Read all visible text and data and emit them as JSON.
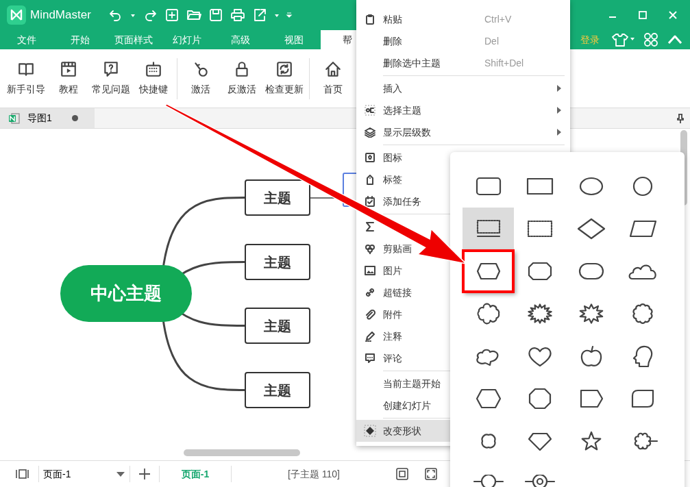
{
  "app": {
    "name": "MindMaster"
  },
  "ribbon_tabs": [
    {
      "label": "文件",
      "selected": false
    },
    {
      "label": "开始",
      "selected": false
    },
    {
      "label": "页面样式",
      "selected": false
    },
    {
      "label": "幻灯片",
      "selected": false
    },
    {
      "label": "高级",
      "selected": false
    },
    {
      "label": "视图",
      "selected": false
    },
    {
      "label": "帮",
      "selected": true
    }
  ],
  "login": "登录",
  "toolbar_groups": [
    [
      {
        "label": "新手引导"
      },
      {
        "label": "教程"
      },
      {
        "label": "常见问题"
      },
      {
        "label": "快捷键"
      }
    ],
    [
      {
        "label": "激活"
      },
      {
        "label": "反激活"
      },
      {
        "label": "检查更新"
      }
    ],
    [
      {
        "label": "首页"
      }
    ]
  ],
  "doc_tabs": [
    {
      "title": "导图1",
      "modified": true
    }
  ],
  "mind_map": {
    "central": "中心主题",
    "topics": [
      "主题",
      "主题",
      "主题",
      "主题"
    ]
  },
  "context_menu": {
    "items": [
      {
        "kind": "item",
        "label": "粘贴",
        "shortcut": "Ctrl+V",
        "submenu": false,
        "selected": false
      },
      {
        "kind": "item",
        "label": "删除",
        "shortcut": "Del",
        "submenu": false,
        "selected": false
      },
      {
        "kind": "item",
        "label": "删除选中主题",
        "shortcut": "Shift+Del",
        "submenu": false,
        "selected": false
      },
      {
        "kind": "separator"
      },
      {
        "kind": "item",
        "label": "插入",
        "submenu": true,
        "selected": false
      },
      {
        "kind": "item",
        "label": "选择主题",
        "submenu": true,
        "selected": false
      },
      {
        "kind": "item",
        "label": "显示层级数",
        "submenu": true,
        "selected": false
      },
      {
        "kind": "separator"
      },
      {
        "kind": "item",
        "label": "图标",
        "submenu": false,
        "selected": false
      },
      {
        "kind": "item",
        "label": "标签",
        "submenu": false,
        "selected": false
      },
      {
        "kind": "item",
        "label": "添加任务",
        "submenu": false,
        "selected": false
      },
      {
        "kind": "separator"
      },
      {
        "kind": "item",
        "submenu": false,
        "selected": false
      },
      {
        "kind": "item",
        "label": "剪贴画",
        "submenu": false,
        "selected": false
      },
      {
        "kind": "item",
        "label": "图片",
        "submenu": false,
        "selected": false
      },
      {
        "kind": "item",
        "label": "超链接",
        "submenu": false,
        "selected": false
      },
      {
        "kind": "item",
        "label": "附件",
        "submenu": false,
        "selected": false
      },
      {
        "kind": "item",
        "label": "注释",
        "submenu": false,
        "selected": false
      },
      {
        "kind": "item",
        "label": "评论",
        "submenu": false,
        "selected": false
      },
      {
        "kind": "separator"
      },
      {
        "kind": "item",
        "label": "当前主题开始",
        "submenu": false,
        "selected": false
      },
      {
        "kind": "item",
        "label": "创建幻灯片",
        "submenu": false,
        "selected": false
      },
      {
        "kind": "separator"
      },
      {
        "kind": "item",
        "label": "改变形状",
        "submenu": false,
        "selected": true
      }
    ]
  },
  "shape_panel": {
    "shapes": [
      {
        "selected": false,
        "highlighted": false
      },
      {
        "selected": false,
        "highlighted": false
      },
      {
        "selected": false,
        "highlighted": false
      },
      {
        "selected": false,
        "highlighted": false
      },
      {
        "selected": true,
        "highlighted": false
      },
      {
        "selected": false,
        "highlighted": false
      },
      {
        "selected": false,
        "highlighted": false
      },
      {
        "selected": false,
        "highlighted": false
      },
      {
        "selected": false,
        "highlighted": true
      },
      {
        "selected": false,
        "highlighted": false
      },
      {
        "selected": false,
        "highlighted": false
      },
      {
        "selected": false,
        "highlighted": false
      },
      {
        "selected": false,
        "highlighted": false
      },
      {
        "selected": false,
        "highlighted": false
      },
      {
        "selected": false,
        "highlighted": false
      },
      {
        "selected": false,
        "highlighted": false
      },
      {
        "selected": false,
        "highlighted": false
      },
      {
        "selected": false,
        "highlighted": false
      },
      {
        "selected": false,
        "highlighted": false
      },
      {
        "selected": false,
        "highlighted": false
      },
      {
        "selected": false,
        "highlighted": false
      },
      {
        "selected": false,
        "highlighted": false
      },
      {
        "selected": false,
        "highlighted": false
      },
      {
        "selected": false,
        "highlighted": false
      },
      {
        "selected": false,
        "highlighted": false
      },
      {
        "selected": false,
        "highlighted": false
      },
      {
        "selected": false,
        "highlighted": false
      },
      {
        "selected": false,
        "highlighted": false
      },
      {
        "selected": false,
        "highlighted": false
      },
      {
        "selected": false,
        "highlighted": false
      }
    ]
  },
  "status_bar": {
    "page_select": "页面-1",
    "page_tabs": [
      {
        "label": "页面-1",
        "selected": true
      }
    ],
    "info": "[子主题 110]"
  }
}
